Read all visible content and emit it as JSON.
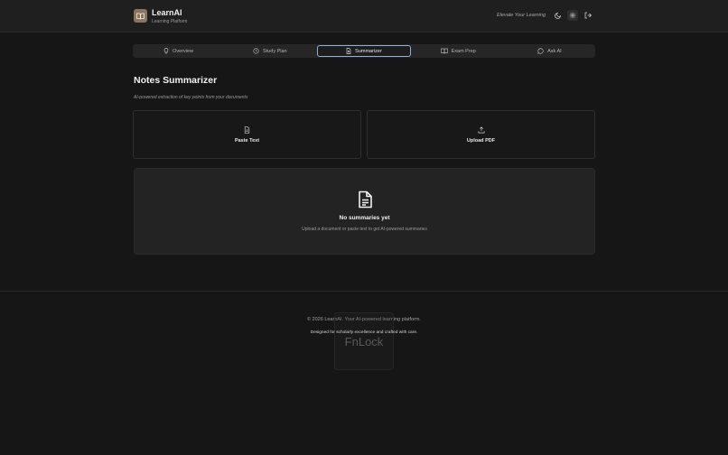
{
  "header": {
    "brand_title": "LearnAI",
    "brand_sub": "Learning Platform",
    "tagline": "Elevate Your Learning",
    "icons": [
      "moon-icon",
      "settings-icon",
      "logout-icon"
    ]
  },
  "tabs": [
    {
      "label": "Overview",
      "icon": "lightbulb-icon"
    },
    {
      "label": "Study Plan",
      "icon": "clock-icon"
    },
    {
      "label": "Summarizer",
      "icon": "document-icon",
      "active": true
    },
    {
      "label": "Exam Prep",
      "icon": "book-icon"
    },
    {
      "label": "Ask AI",
      "icon": "chat-icon"
    }
  ],
  "main": {
    "title": "Notes Summarizer",
    "subtitle": "AI-powered extraction of key points from your documents",
    "cards": [
      {
        "label": "Paste Text",
        "icon": "document-icon"
      },
      {
        "label": "Upload PDF",
        "icon": "upload-icon"
      }
    ],
    "empty": {
      "title": "No summaries yet",
      "subtitle": "Upload a document or paste text to get AI-powered summaries"
    }
  },
  "footer": {
    "line1": "© 2026 LearnAI. Your AI-powered learning platform.",
    "line2": "Designed for scholarly excellence and crafted with care."
  },
  "overlay": {
    "label": "FnLock"
  },
  "colors": {
    "background": "#161616",
    "header": "#1f1f1f",
    "accent_border": "#8fb0d8",
    "logo": "#8a7560"
  }
}
